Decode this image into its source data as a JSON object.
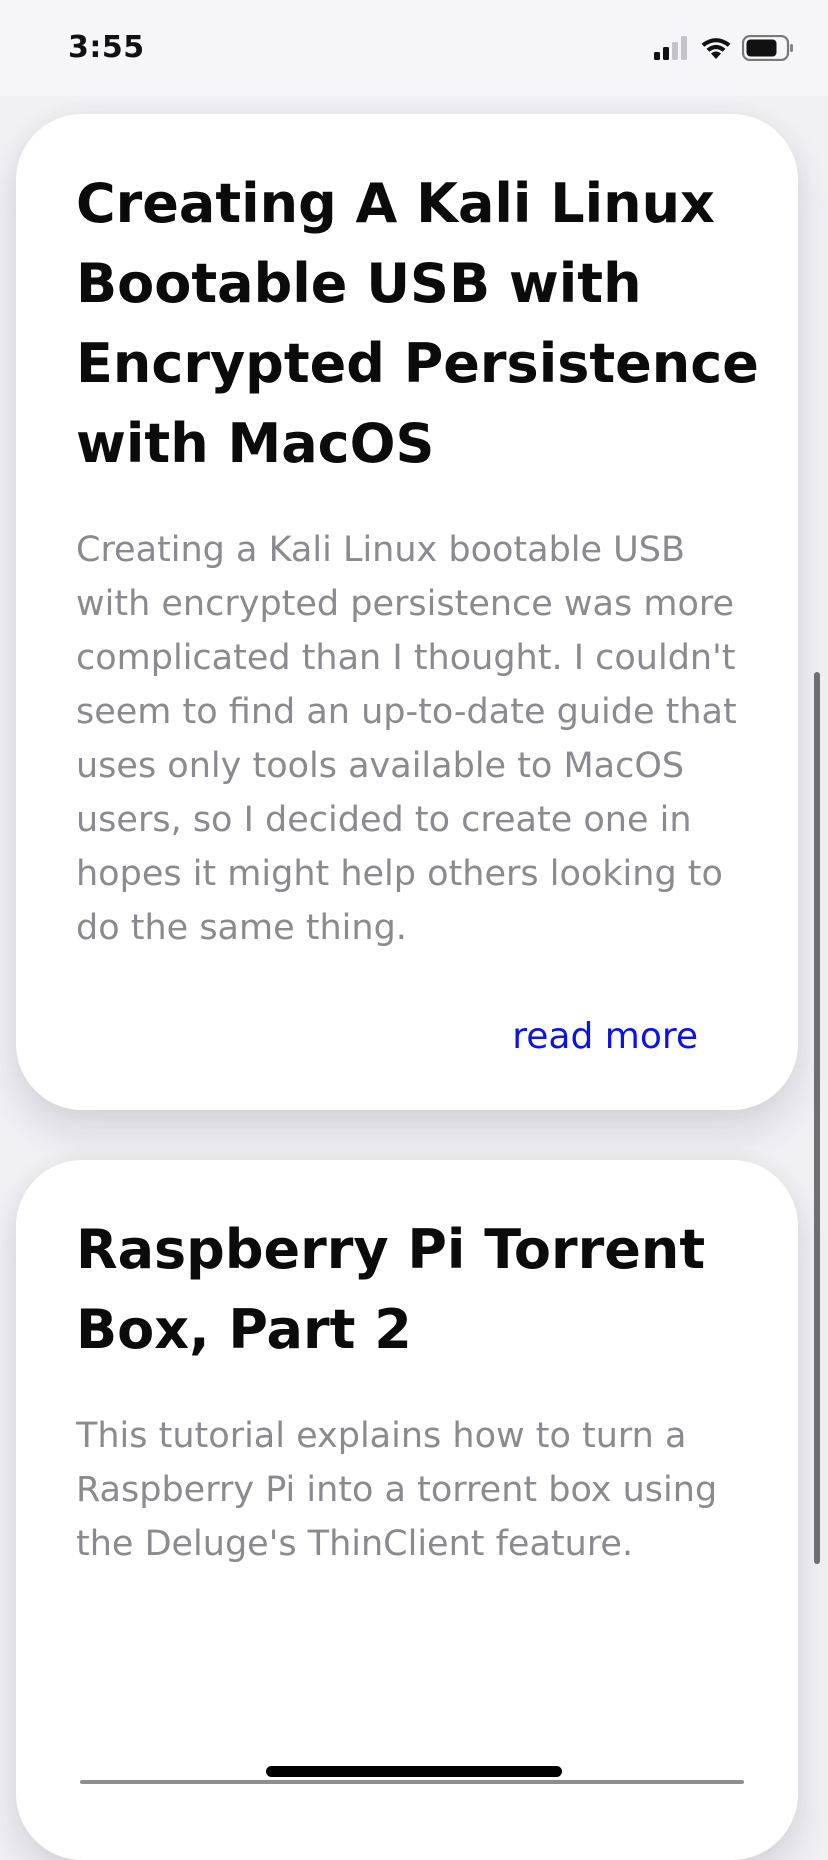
{
  "status_bar": {
    "time": "3:55"
  },
  "articles": [
    {
      "title": "Creating A Kali Linux Bootable USB with Encrypted Persistence with MacOS",
      "description": "Creating a Kali Linux bootable USB with encrypted persistence was more complicated than I thought. I couldn't seem to find an up-to-date guide that uses only tools available to MacOS users, so I decided to create one in hopes it might help others looking to do the same thing.",
      "read_more_label": "read more"
    },
    {
      "title": "Raspberry Pi Torrent Box, Part 2",
      "description": "This tutorial explains how to turn a Raspberry Pi into a torrent box using the Deluge's ThinClient feature."
    }
  ],
  "icons": {
    "signal": "cellular-signal-icon",
    "wifi": "wifi-icon",
    "battery": "battery-icon"
  },
  "colors": {
    "link": "#0a14e6",
    "description": "#8a8a90",
    "title": "#0b0b0b"
  }
}
